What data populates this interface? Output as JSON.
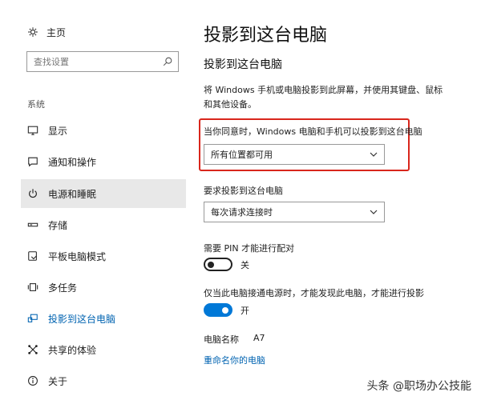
{
  "sidebar": {
    "home_label": "主页",
    "search_placeholder": "查找设置",
    "section_label": "系统",
    "items": [
      {
        "label": "显示",
        "icon": "monitor-icon"
      },
      {
        "label": "通知和操作",
        "icon": "message-icon"
      },
      {
        "label": "电源和睡眠",
        "icon": "power-icon"
      },
      {
        "label": "存储",
        "icon": "storage-icon"
      },
      {
        "label": "平板电脑模式",
        "icon": "tablet-icon"
      },
      {
        "label": "多任务",
        "icon": "multitask-icon"
      },
      {
        "label": "投影到这台电脑",
        "icon": "project-icon"
      },
      {
        "label": "共享的体验",
        "icon": "share-icon"
      },
      {
        "label": "关于",
        "icon": "info-icon"
      }
    ],
    "active_index": 2,
    "selected_index": 6
  },
  "main": {
    "title": "投影到这台电脑",
    "subtitle": "投影到这台电脑",
    "description": "将 Windows 手机或电脑投影到此屏幕，并使用其键盘、鼠标和其他设备。",
    "availability": {
      "label": "当你同意时，Windows 电脑和手机可以投影到这台电脑",
      "value": "所有位置都可用"
    },
    "request": {
      "label": "要求投影到这台电脑",
      "value": "每次请求连接时"
    },
    "pin": {
      "label": "需要 PIN 才能进行配对",
      "state": "off",
      "state_label": "关"
    },
    "power": {
      "label": "仅当此电脑接通电源时，才能发现此电脑，才能进行投影",
      "state": "on",
      "state_label": "开"
    },
    "pc_name": {
      "label": "电脑名称",
      "value": "A7"
    },
    "rename_link": "重命名你的电脑"
  },
  "watermark": "头条 @职场办公技能",
  "colors": {
    "accent": "#0078d7",
    "link": "#0063b1",
    "highlight_border": "#d9261c",
    "active_bg": "#e8e8e8"
  }
}
